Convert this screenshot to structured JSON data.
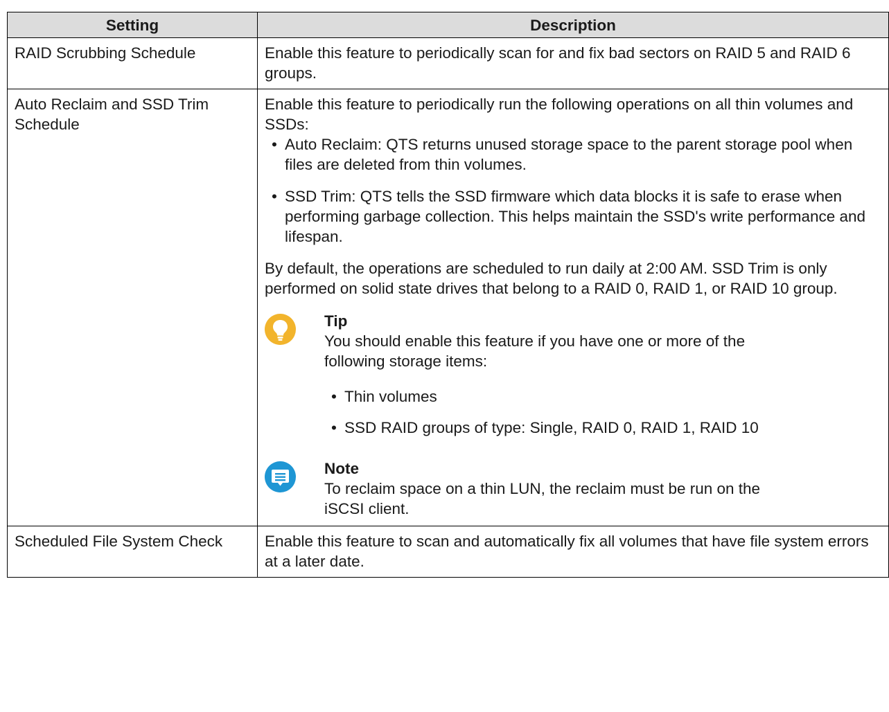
{
  "table": {
    "headers": [
      "Setting",
      "Description"
    ],
    "row1": {
      "setting": "RAID Scrubbing Schedule",
      "description": "Enable this feature to periodically scan for and fix bad sectors on RAID 5 and RAID 6 groups."
    },
    "row2": {
      "setting": "Auto Reclaim and SSD Trim Schedule",
      "intro": "Enable this feature to periodically run the following operations on all thin volumes and SSDs:",
      "bullets": [
        "Auto Reclaim: QTS returns unused storage space to the parent storage pool when files are deleted from thin volumes.",
        "SSD Trim: QTS tells the SSD firmware which data blocks it is safe to erase when performing garbage collection. This helps maintain the SSD's write performance and lifespan."
      ],
      "default_text": "By default, the operations are scheduled to run daily at 2:00 AM. SSD Trim is only performed on solid state drives that belong to a RAID 0, RAID 1, or RAID 10 group.",
      "tip": {
        "title": "Tip",
        "text": "You should enable this feature if you have one or more of the following storage items:",
        "items": [
          "Thin volumes",
          "SSD RAID groups of type: Single, RAID 0, RAID 1, RAID 10"
        ],
        "icon": "lightbulb-icon",
        "color": "#f2b42c"
      },
      "note": {
        "title": "Note",
        "text": "To reclaim space on a thin LUN, the reclaim must be run on the iSCSI client.",
        "icon": "note-icon",
        "color": "#1e96d4"
      }
    },
    "row3": {
      "setting": "Scheduled File System Check",
      "description": "Enable this feature to scan and automatically fix all volumes that have file system errors at a later date."
    }
  }
}
